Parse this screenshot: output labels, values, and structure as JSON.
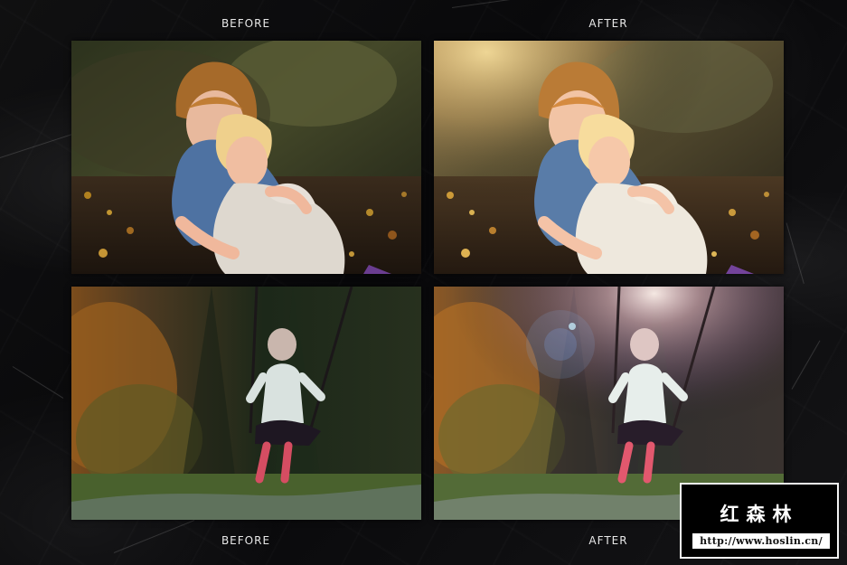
{
  "labels": {
    "top_left": "BEFORE",
    "top_right": "AFTER",
    "bottom_left": "BEFORE",
    "bottom_right": "AFTER"
  },
  "watermark": {
    "name": "红森林",
    "url": "http://www.hoslin.cn/"
  }
}
